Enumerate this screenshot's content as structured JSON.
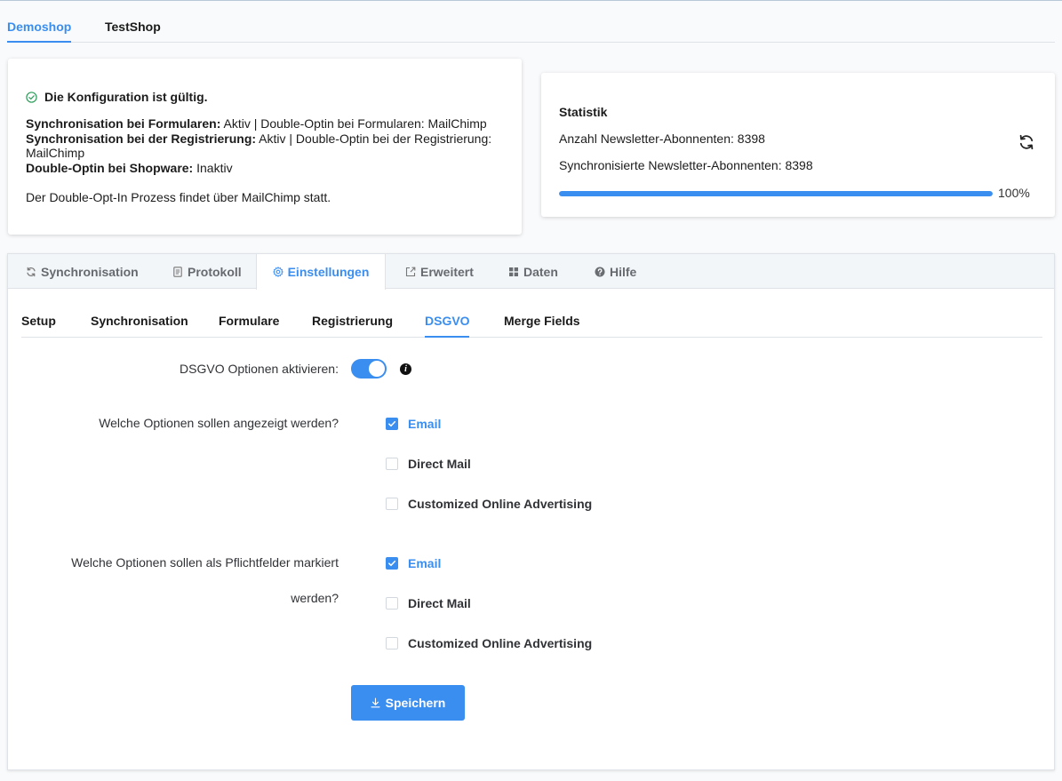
{
  "shop_tabs": [
    {
      "label": "Demoshop",
      "active": true
    },
    {
      "label": "TestShop",
      "active": false
    }
  ],
  "config": {
    "status_icon": "check-circle-icon",
    "status": "Die Konfiguration ist gültig.",
    "forms_sync_label": "Synchronisation bei Formularen:",
    "forms_sync_value": " Aktiv | Double-Optin bei Formularen: MailChimp",
    "registration_sync_label": "Synchronisation bei der Registrierung:",
    "registration_sync_value": " Aktiv | Double-Optin bei der Registrierung: MailChimp",
    "shopware_optin_label": "Double-Optin bei Shopware:",
    "shopware_optin_value": " Inaktiv",
    "note": "Der Double-Opt-In Prozess findet über MailChimp statt."
  },
  "stats": {
    "title": "Statistik",
    "subscribers": "Anzahl Newsletter-Abonnenten: 8398",
    "synced": "Synchronisierte Newsletter-Abonnenten: 8398",
    "progress_percent": 100,
    "progress_text": "100%",
    "refresh_icon": "refresh-icon"
  },
  "main_tabs": [
    {
      "label": "Synchronisation",
      "icon": "sync-icon",
      "active": false
    },
    {
      "label": "Protokoll",
      "icon": "document-icon",
      "active": false
    },
    {
      "label": "Einstellungen",
      "icon": "gear-icon",
      "active": true
    },
    {
      "label": "Erweitert",
      "icon": "external-icon",
      "active": false
    },
    {
      "label": "Daten",
      "icon": "grid-icon",
      "active": false
    },
    {
      "label": "Hilfe",
      "icon": "help-icon",
      "active": false
    }
  ],
  "sub_tabs": [
    {
      "label": "Setup",
      "active": false
    },
    {
      "label": "Synchronisation",
      "active": false
    },
    {
      "label": "Formulare",
      "active": false
    },
    {
      "label": "Registrierung",
      "active": false
    },
    {
      "label": "DSGVO",
      "active": true
    },
    {
      "label": "Merge Fields",
      "active": false
    }
  ],
  "dsgvo": {
    "enable_label": "DSGVO Optionen aktivieren:",
    "enable_value": true,
    "info_icon": "info-icon",
    "show_options_label": "Welche Optionen sollen angezeigt werden?",
    "show_options": [
      {
        "label": "Email",
        "checked": true
      },
      {
        "label": "Direct Mail",
        "checked": false
      },
      {
        "label": "Customized Online Advertising",
        "checked": false
      }
    ],
    "required_label_line1": "Welche Optionen sollen als Pflichtfelder markiert",
    "required_label_line2": "werden?",
    "required_options": [
      {
        "label": "Email",
        "checked": true
      },
      {
        "label": "Direct Mail",
        "checked": false
      },
      {
        "label": "Customized Online Advertising",
        "checked": false
      }
    ]
  },
  "save": {
    "label": "Speichern",
    "icon": "download-icon"
  },
  "colors": {
    "accent": "#3a8ef0",
    "success": "#2e9e5b",
    "tab_bar_bg": "#f3f6f9"
  }
}
